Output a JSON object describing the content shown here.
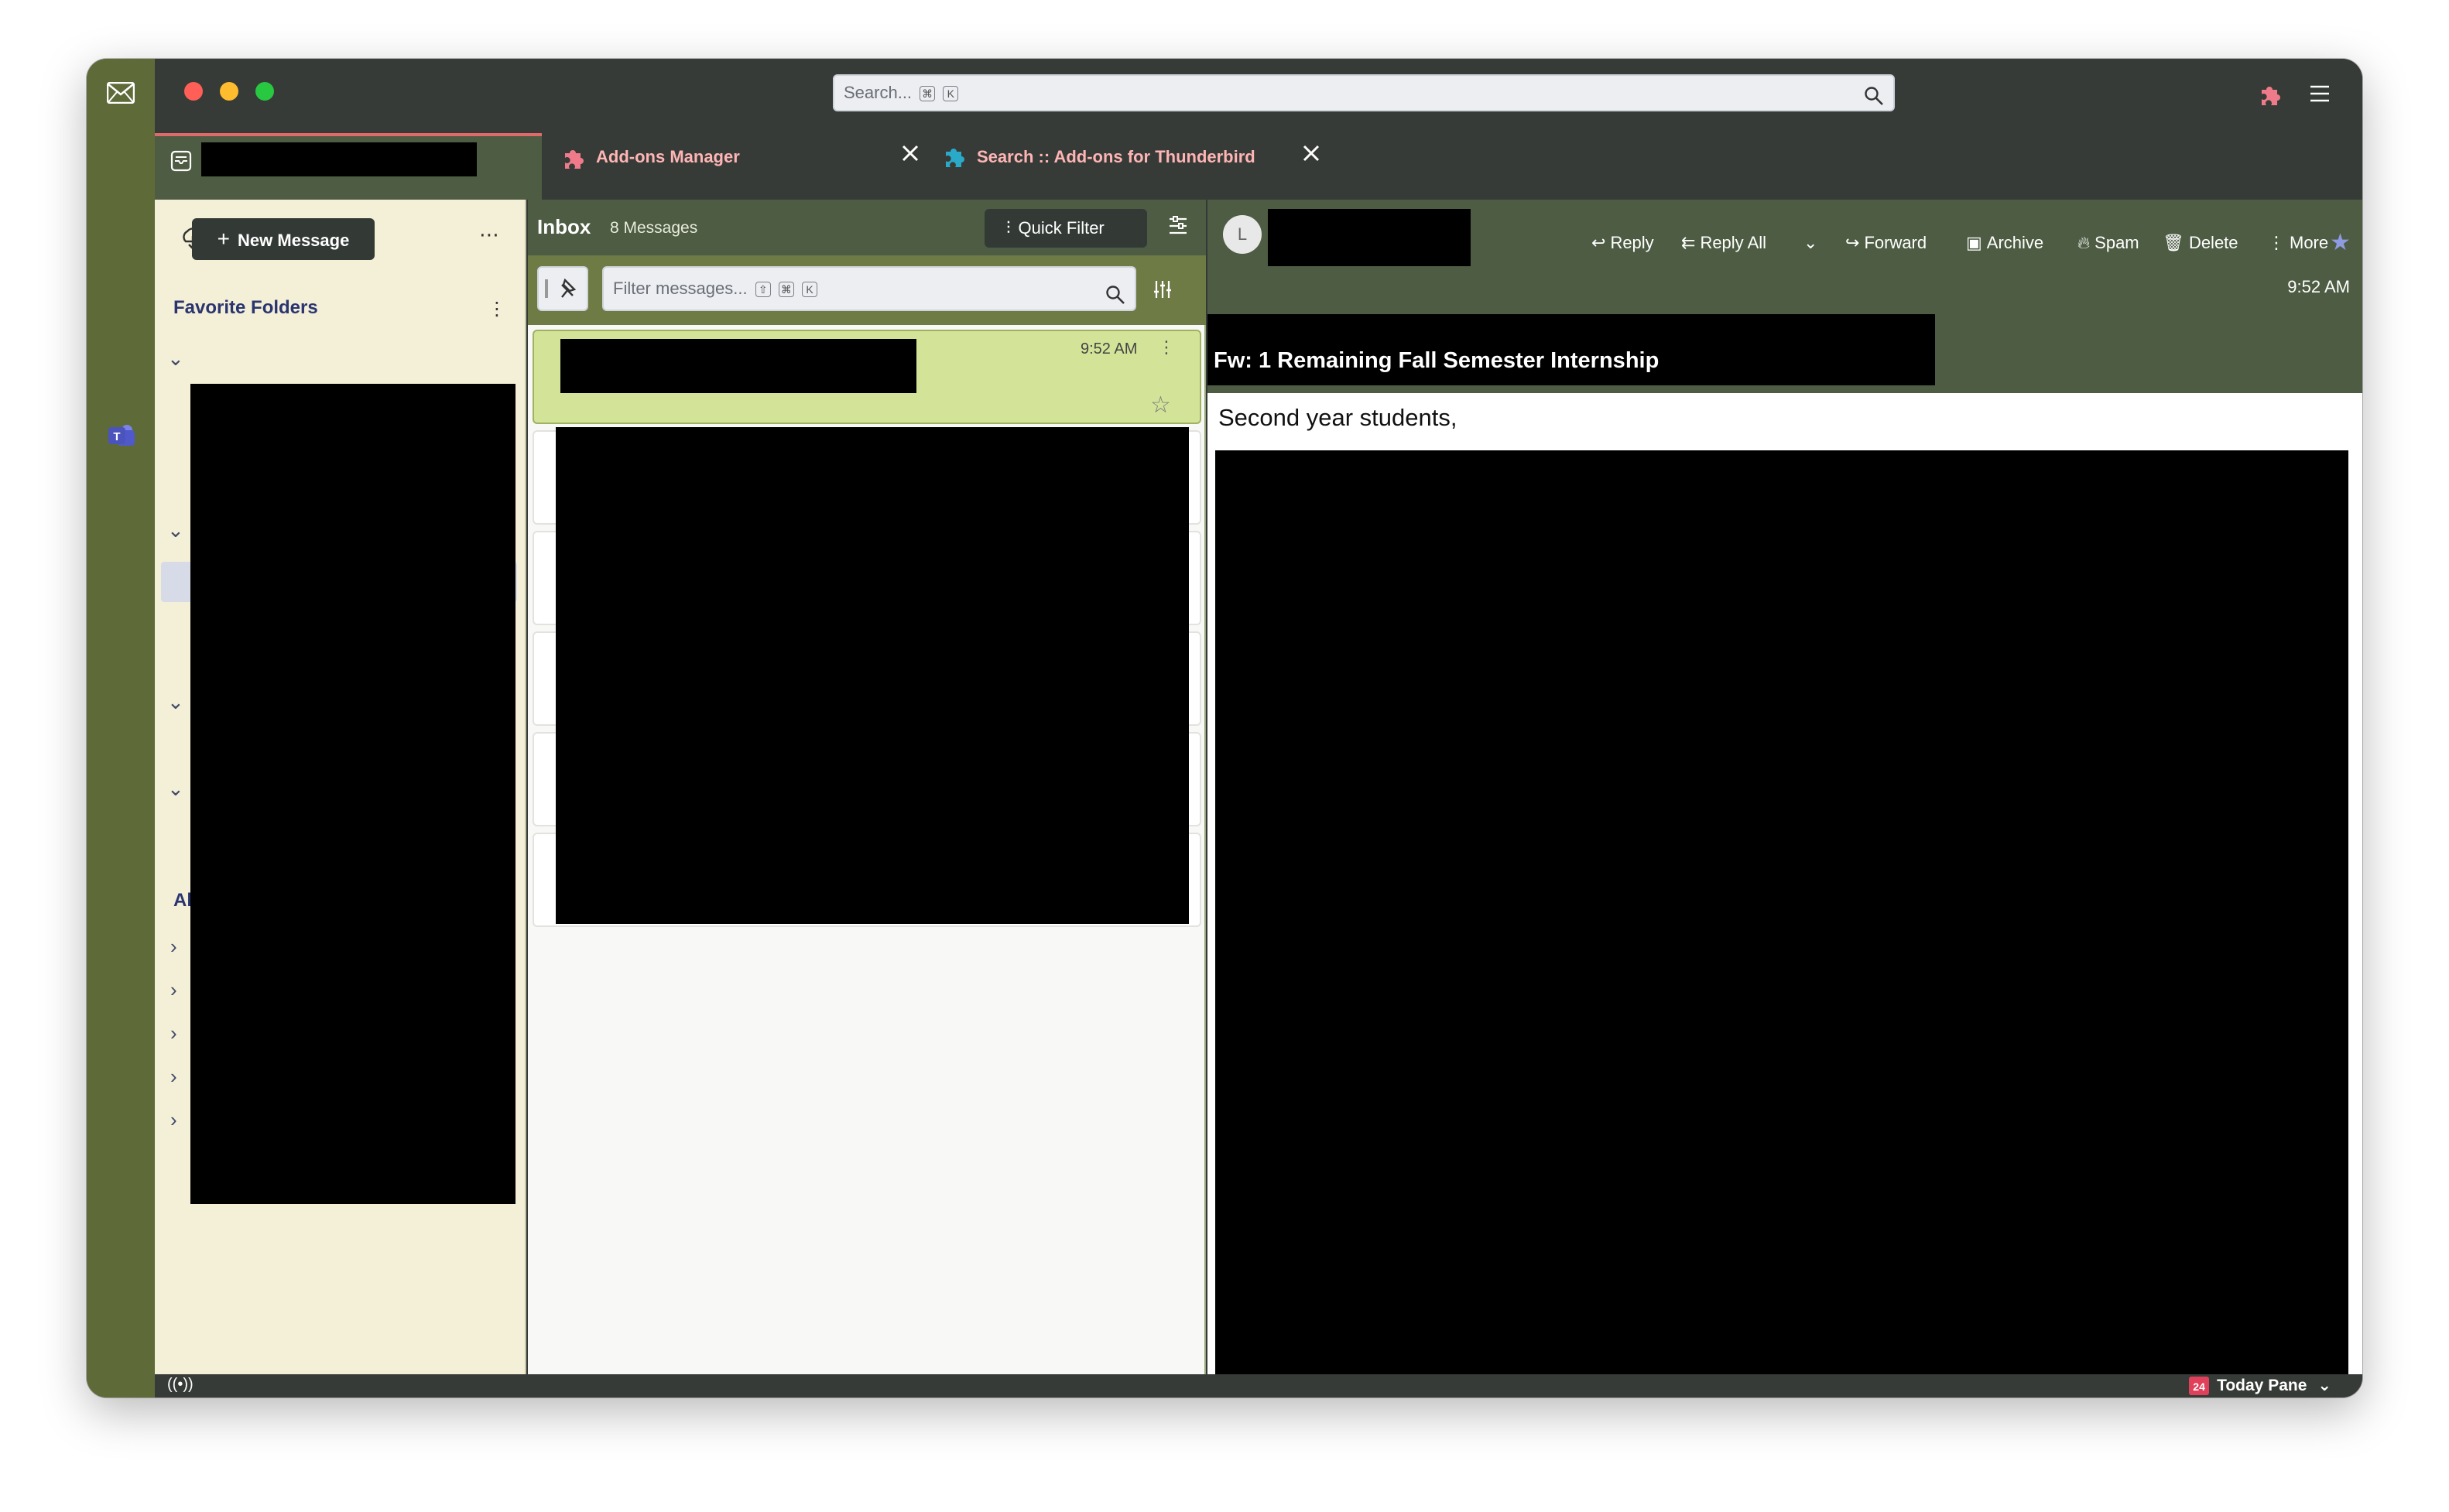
{
  "window": {
    "search_placeholder": "Search...",
    "search_shortcut_keys": [
      "⌘",
      "K"
    ],
    "traffic_lights": {
      "close": "#ff5f57",
      "minimize": "#febc2e",
      "zoom": "#28c840"
    }
  },
  "tabs": [
    {
      "label": "",
      "redacted": true
    },
    {
      "label": "Add-ons Manager"
    },
    {
      "label": "Search :: Add-ons for Thunderbird"
    }
  ],
  "folder_pane": {
    "new_message_label": "New Message",
    "more_label": "⋯",
    "favorite_folders_label": "Favorite Folders",
    "all_folders_label": "Al"
  },
  "thread_pane": {
    "folder_name": "Inbox",
    "message_count": "8 Messages",
    "quick_filter_label": "Quick Filter",
    "filter_placeholder": "Filter messages...",
    "filter_shortcut_keys": [
      "⇧",
      "⌘",
      "K"
    ],
    "selected_time": "9:52 AM"
  },
  "message": {
    "avatar_letter": "L",
    "actions": {
      "reply": "Reply",
      "reply_all": "Reply All",
      "forward": "Forward",
      "archive": "Archive",
      "spam": "Spam",
      "delete": "Delete",
      "more": "More"
    },
    "time": "9:52 AM",
    "subject": "Fw: 1 Remaining Fall Semester Internship",
    "body_first_line": "Second year students,"
  },
  "status_bar": {
    "today_pane_label": "Today Pane",
    "calendar_day": "24"
  },
  "colors": {
    "accent_green": "#4d5c43",
    "selected_row": "#d3e498",
    "folder_bg": "#f4efd7",
    "spaces_bar": "#5e6b39"
  }
}
